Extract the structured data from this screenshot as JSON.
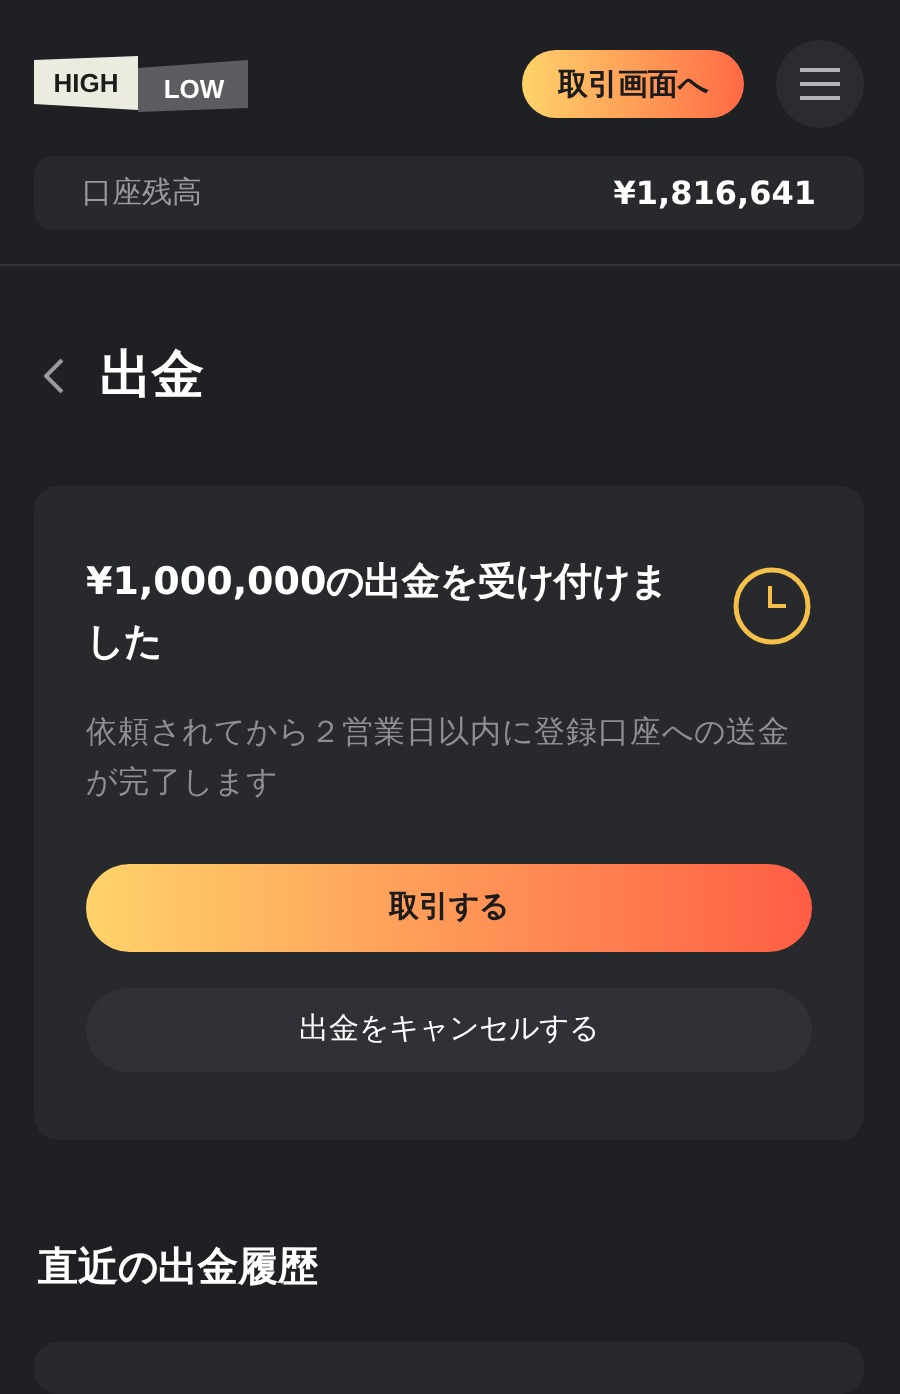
{
  "header": {
    "logo": {
      "high": "HIGH",
      "low": "LOW"
    },
    "trade_screen_button": "取引画面へ"
  },
  "balance": {
    "label": "口座残高",
    "value": "¥1,816,641"
  },
  "page_title": "出金",
  "status_card": {
    "title": "¥1,000,000の出金を受け付けました",
    "description": "依頼されてから２営業日以内に登録口座への送金が完了します",
    "buttons": [
      {
        "label": "取引する",
        "kind": "primary"
      },
      {
        "label": "出金をキャンセルする",
        "kind": "secondary"
      }
    ]
  },
  "history": {
    "title": "直近の出金履歴"
  }
}
